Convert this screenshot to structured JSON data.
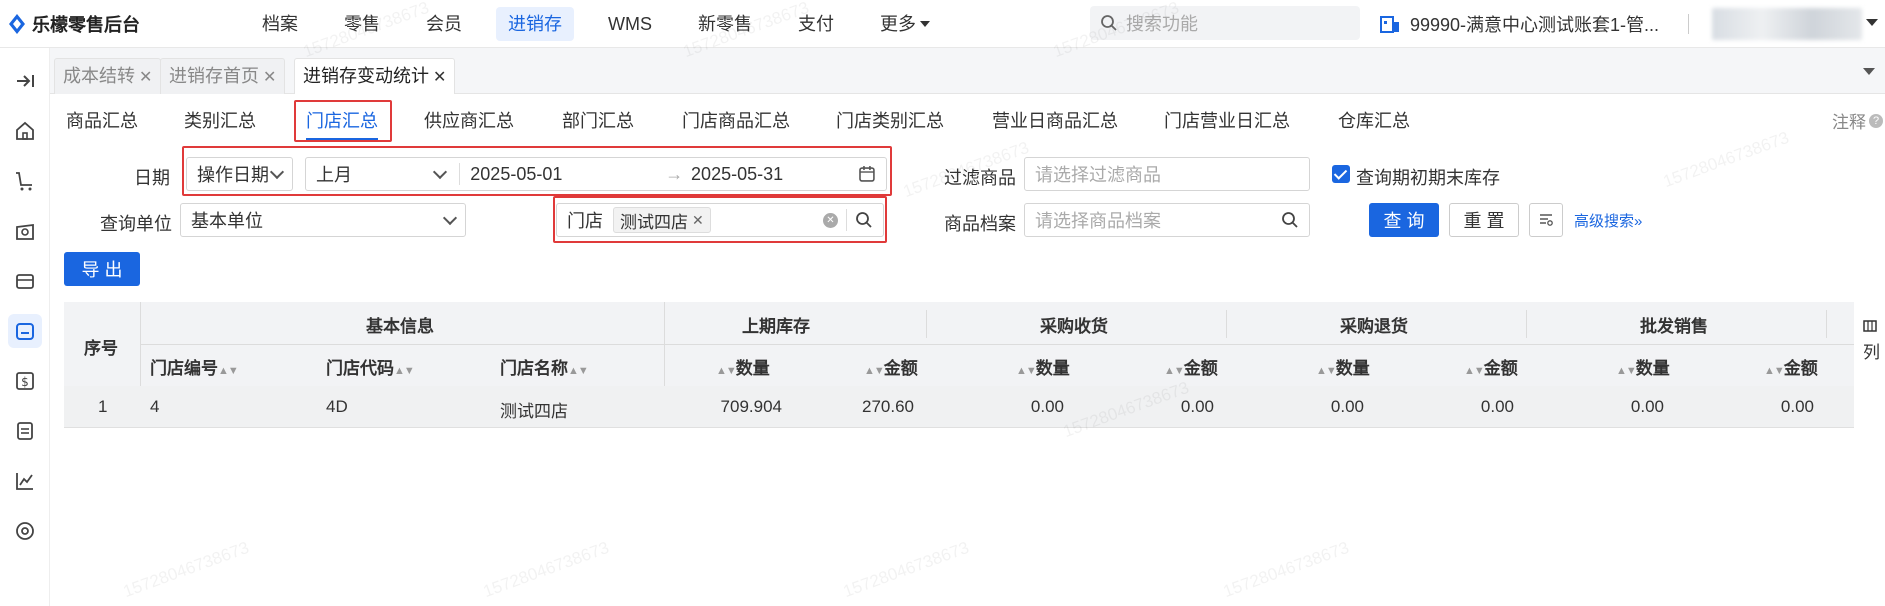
{
  "app": {
    "logo_text": "乐檬零售后台"
  },
  "nav": {
    "items": [
      "档案",
      "零售",
      "会员",
      "进销存",
      "WMS",
      "新零售",
      "支付",
      "更多"
    ],
    "active": "进销存"
  },
  "search": {
    "placeholder": "搜索功能"
  },
  "account": {
    "label": "99990-满意中心测试账套1-管..."
  },
  "page_tabs": [
    {
      "label": "成本结转",
      "active": false
    },
    {
      "label": "进销存首页",
      "active": false
    },
    {
      "label": "进销存变动统计",
      "active": true
    }
  ],
  "report_tabs": [
    "商品汇总",
    "类别汇总",
    "门店汇总",
    "供应商汇总",
    "部门汇总",
    "门店商品汇总",
    "门店类别汇总",
    "营业日商品汇总",
    "门店营业日汇总",
    "仓库汇总"
  ],
  "report_tab_active": "门店汇总",
  "note": "注释",
  "filters": {
    "date_label": "日期",
    "date_type": "操作日期",
    "period": "上月",
    "start_date": "2025-05-01",
    "range_sep": "→",
    "end_date": "2025-05-31",
    "filter_goods_label": "过滤商品",
    "filter_goods_placeholder": "请选择过滤商品",
    "include_stock_label": "查询期初期末库存",
    "unit_label": "查询单位",
    "unit_value": "基本单位",
    "store_label": "门店",
    "store_chip": "测试四店",
    "goods_archive_label": "商品档案",
    "goods_archive_placeholder": "请选择商品档案"
  },
  "buttons": {
    "query": "查 询",
    "reset": "重 置",
    "advanced": "高级搜索",
    "export": "导 出"
  },
  "table": {
    "col_index": "序号",
    "groups": [
      "基本信息",
      "上期库存",
      "采购收货",
      "采购退货",
      "批发销售"
    ],
    "basic_cols": [
      "门店编号",
      "门店代码",
      "门店名称"
    ],
    "qty": "数量",
    "amount": "金额",
    "rows": [
      {
        "index": "1",
        "store_no": "4",
        "store_code": "4D",
        "store_name": "测试四店",
        "prev_qty": "709.904",
        "prev_amt": "270.60",
        "recv_qty": "0.00",
        "recv_amt": "0.00",
        "ret_qty": "0.00",
        "ret_amt": "0.00",
        "whs_qty": "0.00",
        "whs_amt": "0.00"
      }
    ]
  },
  "right_edge": "列",
  "watermark": "15728046738673",
  "colors": {
    "accent": "#1a66e0",
    "highlight_border": "#e03a3a"
  }
}
